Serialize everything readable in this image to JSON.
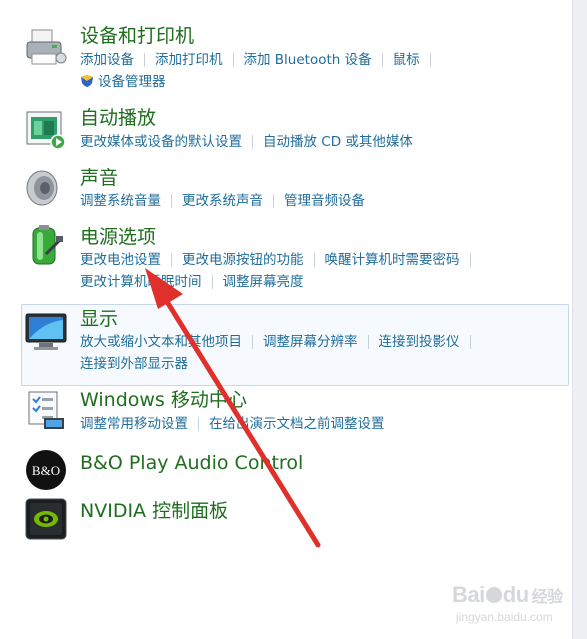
{
  "devices": {
    "title": "设备和打印机",
    "links": [
      "添加设备",
      "添加打印机",
      "添加 Bluetooth 设备",
      "鼠标"
    ],
    "extra": "设备管理器"
  },
  "autoplay": {
    "title": "自动播放",
    "links": [
      "更改媒体或设备的默认设置",
      "自动播放 CD 或其他媒体"
    ]
  },
  "sound": {
    "title": "声音",
    "links": [
      "调整系统音量",
      "更改系统声音",
      "管理音频设备"
    ]
  },
  "power": {
    "title": "电源选项",
    "links": [
      "更改电池设置",
      "更改电源按钮的功能",
      "唤醒计算机时需要密码",
      "更改计算机睡眠时间",
      "调整屏幕亮度"
    ]
  },
  "display": {
    "title": "显示",
    "links": [
      "放大或缩小文本和其他项目",
      "调整屏幕分辨率",
      "连接到投影仪",
      "连接到外部显示器"
    ]
  },
  "mobility": {
    "title": "Windows 移动中心",
    "links": [
      "调整常用移动设置",
      "在给出演示文档之前调整设置"
    ]
  },
  "bo": {
    "title": "B&O Play Audio Control",
    "icon_text": "B&O"
  },
  "nvidia": {
    "title": "NVIDIA 控制面板"
  },
  "watermark": {
    "main": "Bai",
    "du": "du",
    "char": "经验",
    "sub": "jingyan.baidu.com"
  },
  "colors": {
    "title_green": "#1e6e1e",
    "link_blue": "#1f6d9b",
    "arrow_red": "#e0302c",
    "highlight_bg": "#f6f9fd"
  }
}
